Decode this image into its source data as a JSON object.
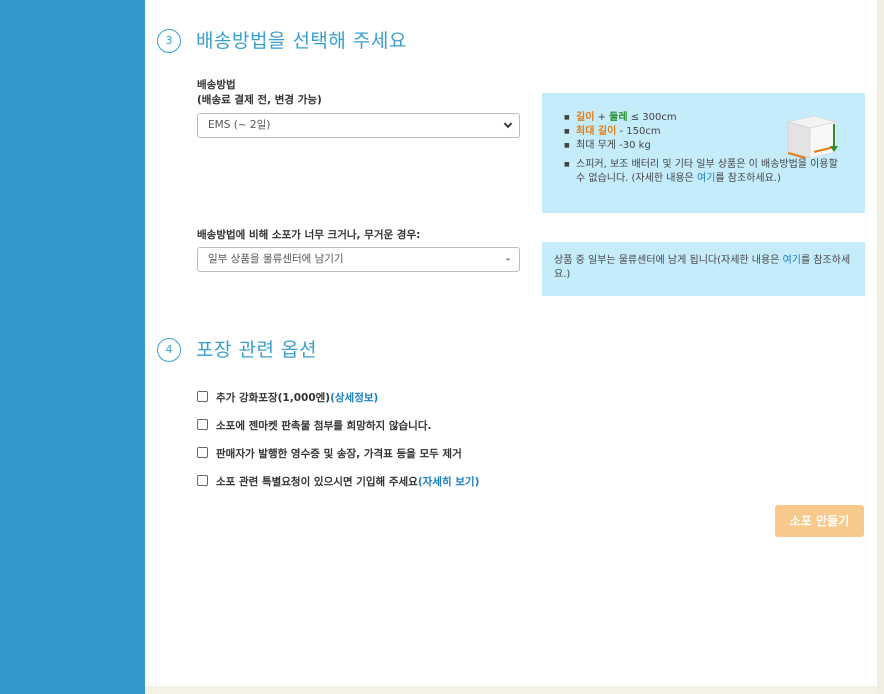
{
  "step3": {
    "number": "3",
    "title": "배송방법을 선택해 주세요",
    "shipping_label_line1": "배송방법",
    "shipping_label_line2": "(배송료 결제 전, 변경 가능)",
    "shipping_select_value": "EMS (~ 2일)",
    "info": {
      "length_label": "길이",
      "plus": " + ",
      "girth_label": "둘레",
      "limit_text": " ≤ 300cm",
      "max_length_label": "최대 길이",
      "max_length_value": " - 150cm",
      "max_weight": "최대 무게 -30 kg",
      "note_pre": "스피커, 보조 배터리 및 기타 일부 상품은 이 배송방법을 이용할 수 없습니다. (자세한 내용은 ",
      "note_link": "여기",
      "note_post": "를 참조하세요.)"
    },
    "oversize_label": "배송방법에 비해 소포가 너무 크거나, 무거운 경우:",
    "oversize_select_value": "일부 상품을 물류센터에 남기기",
    "oversize_info_pre": "상품 중 일부는 물류센터에 남게 됩니다(자세한 내용은 ",
    "oversize_info_link": "여기",
    "oversize_info_post": "를 참조하세요.)"
  },
  "step4": {
    "number": "4",
    "title": "포장 관련 옵션",
    "options": [
      {
        "text": "추가 강화포장(1,000엔)",
        "link": "(상세정보)"
      },
      {
        "text": "소포에 젠마켓 판촉물 첨부를 희망하지 않습니다.",
        "link": ""
      },
      {
        "text": "판매자가 발행한 영수증 및 송장, 가격표 등을 모두 제거",
        "link": ""
      },
      {
        "text": "소포 관련 특별요청이 있으시면 기입해 주세요",
        "link": "(자세히 보기)"
      }
    ]
  },
  "create_button": "소포 만들기",
  "colors": {
    "sidebar": "#3399cc",
    "accent": "#3a9fcf",
    "infobox": "#c5ecfb",
    "button": "#f7c98a",
    "orange": "#e57e17",
    "green": "#2e8b2e"
  }
}
